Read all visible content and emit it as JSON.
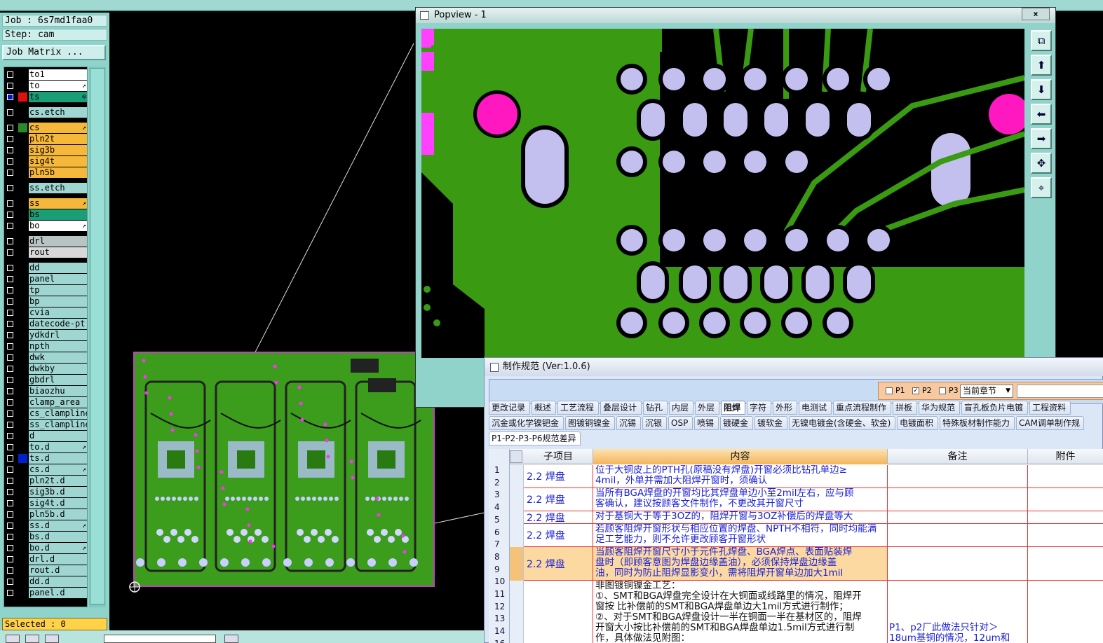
{
  "app": {
    "job_label": "Job : 6s7md1faa0",
    "step_label": "Step: cam",
    "job_matrix_button": "Job Matrix ...",
    "selected_label": "Selected : 0"
  },
  "layers": [
    {
      "name": "to1",
      "color": "#ffffff",
      "swatch": "#000000",
      "mark": "",
      "selected": false
    },
    {
      "name": "to",
      "color": "#ffffff",
      "swatch": "#000000",
      "mark": "↗",
      "selected": false
    },
    {
      "name": "ts",
      "color": "#1a9e78",
      "swatch": "#e01010",
      "mark": "⊙",
      "selected": true
    },
    {
      "name": "cs.etch",
      "color": "#9fd6d2",
      "swatch": "#000000",
      "mark": "",
      "selected": false
    },
    {
      "name": "cs",
      "color": "#f5b83a",
      "swatch": "#2a8a2a",
      "mark": "↗",
      "selected": false
    },
    {
      "name": "pln2t",
      "color": "#f5b83a",
      "swatch": "#000000",
      "mark": "",
      "selected": false
    },
    {
      "name": "sig3b",
      "color": "#f5b83a",
      "swatch": "#000000",
      "mark": "",
      "selected": false
    },
    {
      "name": "sig4t",
      "color": "#f5b83a",
      "swatch": "#000000",
      "mark": "",
      "selected": false
    },
    {
      "name": "pln5b",
      "color": "#f5b83a",
      "swatch": "#000000",
      "mark": "",
      "selected": false
    },
    {
      "name": "ss.etch",
      "color": "#9fd6d2",
      "swatch": "#000000",
      "mark": "",
      "selected": false
    },
    {
      "name": "ss",
      "color": "#f5b83a",
      "swatch": "#000000",
      "mark": "↗",
      "selected": false
    },
    {
      "name": "bs",
      "color": "#1a9e78",
      "swatch": "#000000",
      "mark": "",
      "selected": false
    },
    {
      "name": "bo",
      "color": "#ffffff",
      "swatch": "#000000",
      "mark": "↗",
      "selected": false
    },
    {
      "name": "drl",
      "color": "#b8c4c4",
      "swatch": "#000000",
      "mark": "",
      "selected": false
    },
    {
      "name": "rout",
      "color": "#d8d8d8",
      "swatch": "#000000",
      "mark": "",
      "selected": false
    },
    {
      "name": "dd",
      "color": "#9fd6d2",
      "swatch": "#000000",
      "mark": "",
      "selected": false
    },
    {
      "name": "panel",
      "color": "#9fd6d2",
      "swatch": "#000000",
      "mark": "",
      "selected": false
    },
    {
      "name": "tp",
      "color": "#9fd6d2",
      "swatch": "#000000",
      "mark": "",
      "selected": false
    },
    {
      "name": "bp",
      "color": "#9fd6d2",
      "swatch": "#000000",
      "mark": "",
      "selected": false
    },
    {
      "name": "cvia",
      "color": "#9fd6d2",
      "swatch": "#000000",
      "mark": "",
      "selected": false
    },
    {
      "name": "datecode-pt",
      "color": "#9fd6d2",
      "swatch": "#000000",
      "mark": "",
      "selected": false
    },
    {
      "name": "ydkdrl",
      "color": "#9fd6d2",
      "swatch": "#000000",
      "mark": "",
      "selected": false
    },
    {
      "name": "npth",
      "color": "#9fd6d2",
      "swatch": "#000000",
      "mark": "",
      "selected": false
    },
    {
      "name": "dwk",
      "color": "#9fd6d2",
      "swatch": "#000000",
      "mark": "",
      "selected": false
    },
    {
      "name": "dwkby",
      "color": "#9fd6d2",
      "swatch": "#000000",
      "mark": "",
      "selected": false
    },
    {
      "name": "gbdrl",
      "color": "#9fd6d2",
      "swatch": "#000000",
      "mark": "",
      "selected": false
    },
    {
      "name": "biaozhu",
      "color": "#9fd6d2",
      "swatch": "#000000",
      "mark": "",
      "selected": false
    },
    {
      "name": "clamp_area",
      "color": "#9fd6d2",
      "swatch": "#000000",
      "mark": "",
      "selected": false
    },
    {
      "name": "cs_clampline",
      "color": "#9fd6d2",
      "swatch": "#000000",
      "mark": "",
      "selected": false
    },
    {
      "name": "ss_clampline",
      "color": "#9fd6d2",
      "swatch": "#000000",
      "mark": "",
      "selected": false
    },
    {
      "name": "d",
      "color": "#9fd6d2",
      "swatch": "#000000",
      "mark": "",
      "selected": false
    },
    {
      "name": "to.d",
      "color": "#9fd6d2",
      "swatch": "#000000",
      "mark": "↗",
      "selected": false
    },
    {
      "name": "ts.d",
      "color": "#9fd6d2",
      "swatch": "#0020d0",
      "mark": "",
      "selected": false
    },
    {
      "name": "cs.d",
      "color": "#9fd6d2",
      "swatch": "#000000",
      "mark": "↗",
      "selected": false
    },
    {
      "name": "pln2t.d",
      "color": "#9fd6d2",
      "swatch": "#000000",
      "mark": "",
      "selected": false
    },
    {
      "name": "sig3b.d",
      "color": "#9fd6d2",
      "swatch": "#000000",
      "mark": "",
      "selected": false
    },
    {
      "name": "sig4t.d",
      "color": "#9fd6d2",
      "swatch": "#000000",
      "mark": "",
      "selected": false
    },
    {
      "name": "pln5b.d",
      "color": "#9fd6d2",
      "swatch": "#000000",
      "mark": "",
      "selected": false
    },
    {
      "name": "ss.d",
      "color": "#9fd6d2",
      "swatch": "#000000",
      "mark": "↗",
      "selected": false
    },
    {
      "name": "bs.d",
      "color": "#9fd6d2",
      "swatch": "#000000",
      "mark": "",
      "selected": false
    },
    {
      "name": "bo.d",
      "color": "#9fd6d2",
      "swatch": "#000000",
      "mark": "↗",
      "selected": false
    },
    {
      "name": "drl.d",
      "color": "#9fd6d2",
      "swatch": "#000000",
      "mark": "",
      "selected": false
    },
    {
      "name": "rout.d",
      "color": "#9fd6d2",
      "swatch": "#000000",
      "mark": "",
      "selected": false
    },
    {
      "name": "dd.d",
      "color": "#9fd6d2",
      "swatch": "#000000",
      "mark": "",
      "selected": false
    },
    {
      "name": "panel.d",
      "color": "#9fd6d2",
      "swatch": "#000000",
      "mark": "",
      "selected": false
    }
  ],
  "popview": {
    "title": "Popview - 1",
    "close_label": "×",
    "tool_icons": [
      "zoom-fit-icon",
      "pan-up-icon",
      "pan-down-icon",
      "pan-left-icon",
      "pan-right-icon",
      "zoom-in-icon",
      "zoom-out-icon"
    ],
    "tool_glyphs": [
      "⧉",
      "⬆",
      "⬇",
      "⬅",
      "➡",
      "✥",
      "⌖"
    ]
  },
  "spec": {
    "title": "制作规范 (Ver:1.0.6)",
    "p_checks": [
      {
        "label": "P1",
        "checked": false
      },
      {
        "label": "P2",
        "checked": true
      },
      {
        "label": "P3",
        "checked": false
      }
    ],
    "chapter_select": "当前章节",
    "tabs_row1": [
      {
        "label": "更改记录",
        "active": false
      },
      {
        "label": "概述",
        "active": false
      },
      {
        "label": "工艺流程",
        "active": false
      },
      {
        "label": "叠层设计",
        "active": false
      },
      {
        "label": "钻孔",
        "active": false
      },
      {
        "label": "内层",
        "active": false
      },
      {
        "label": "外层",
        "active": false
      },
      {
        "label": "阻焊",
        "active": true
      },
      {
        "label": "字符",
        "active": false
      },
      {
        "label": "外形",
        "active": false
      },
      {
        "label": "电测试",
        "active": false
      },
      {
        "label": "重点流程制作",
        "active": false
      },
      {
        "label": "拼板",
        "active": false
      },
      {
        "label": "华为规范",
        "active": false
      },
      {
        "label": "盲孔板负片电镀",
        "active": false
      },
      {
        "label": "工程资料",
        "active": false
      }
    ],
    "tabs_row2": [
      "沉金或化学镍钯金",
      "图镀铜镍金",
      "沉锡",
      "沉银",
      "OSP",
      "喷锡",
      "镀硬金",
      "镀软金",
      "无镍电镀金(含硬金、软金)",
      "电镀面积",
      "特殊板材制作能力",
      "CAM调单制作规"
    ],
    "tabs_row3": [
      "P1-P2-P3-P6规范差异"
    ],
    "columns": [
      "子项目",
      "内容",
      "备注",
      "附件"
    ],
    "row_numbers": [
      "1",
      "2",
      "3",
      "4",
      "5",
      "6",
      "7",
      "8",
      "9",
      "10",
      "11",
      "12",
      "13",
      "14",
      "16"
    ],
    "rows": [
      {
        "sub": "2.2 焊盘",
        "lines": [
          "位于大铜皮上的PTH孔(原稿没有焊盘)开窗必须比钻孔单边≥",
          "4mil，外单并需加大阻焊开窗时，须确认"
        ],
        "note": [],
        "style": "normal"
      },
      {
        "sub": "2.2 焊盘",
        "lines": [
          "当所有BGA焊盘的开窗均比其焊盘单边小至2mil左右，应与顾",
          "客确认，建议按顾客文件制作，不更改其开窗尺寸"
        ],
        "note": [],
        "style": "normal"
      },
      {
        "sub": "2.2 焊盘",
        "lines": [
          "对于基铜大于等于3OZ的，阻焊开窗与3OZ补偿后的焊盘等大"
        ],
        "note": [],
        "style": "normal"
      },
      {
        "sub": "2.2 焊盘",
        "lines": [
          "若顾客阻焊开窗形状与相应位置的焊盘、NPTH不相符，同时均能满",
          "足工艺能力，则不允许更改顾客开窗形状"
        ],
        "note": [],
        "style": "normal"
      },
      {
        "sub": "2.2 焊盘",
        "lines": [
          "当顾客阻焊开窗尺寸小于元件孔焊盘、BGA焊点、表面贴装焊",
          "盘时（即顾客意图为焊盘边缘盖油），必须保持焊盘边缘盖",
          "油，同时为防止阻焊显影变小，需将阻焊开窗单边加大1mil"
        ],
        "note": [],
        "style": "highlight"
      },
      {
        "sub": "",
        "lines": [
          "非图镀铜镍金工艺：",
          "①、SMT和BGA焊盘完全设计在大铜面或线路里的情况，阻焊开",
          "窗按 比补偿前的SMT和BGA焊盘单边大1mil方式进行制作；",
          "②、对于SMT和BGA焊盘设计一半在铜面一半在基材区的，阻焊",
          "开窗大小按比补偿前的SMT和BGA焊盘单边1.5mil方式进行制",
          "作，具体做法见附图："
        ],
        "note": [
          "",
          "",
          "",
          "",
          "P1、p2厂此做法只针对＞",
          "18um基铜的情况，12um和"
        ],
        "style": "black"
      }
    ]
  }
}
